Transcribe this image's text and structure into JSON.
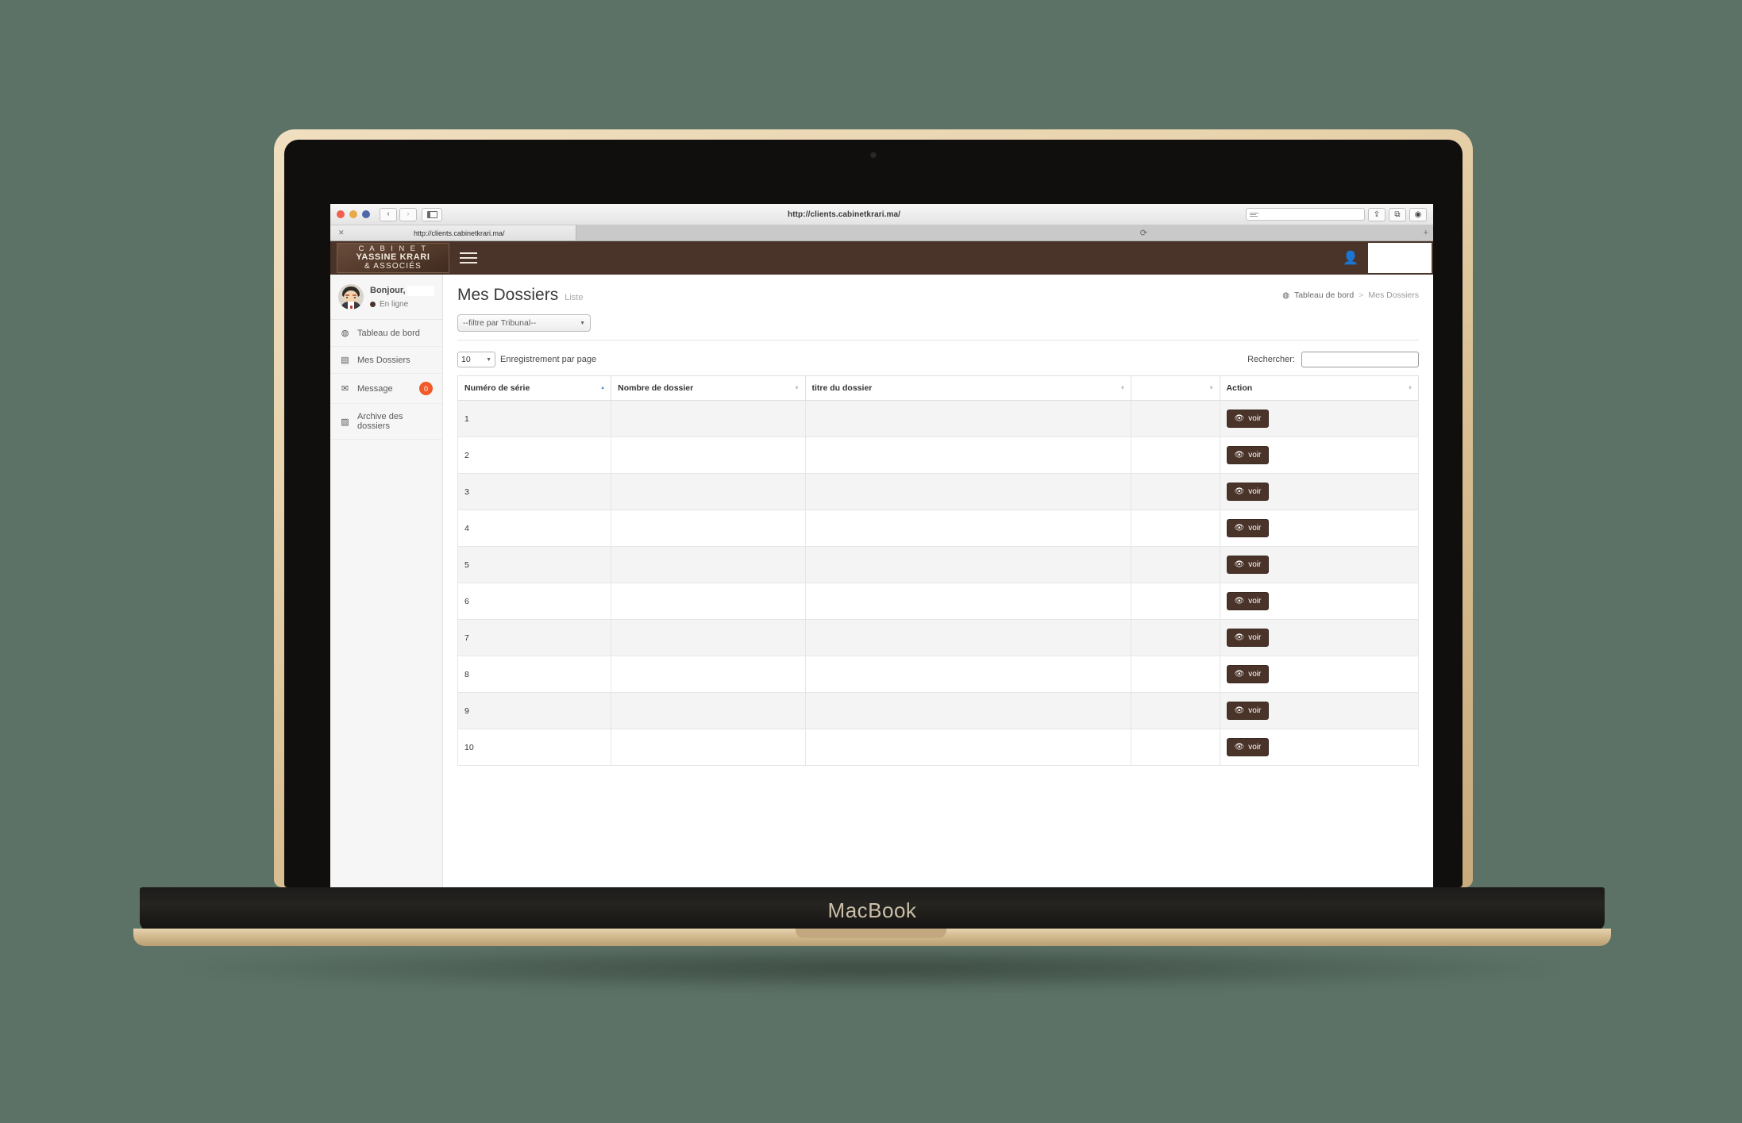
{
  "device": {
    "brand_label": "MacBook"
  },
  "browser": {
    "window_title": "http://clients.cabinetkrari.ma/",
    "back_icon": "‹",
    "forward_icon": "›",
    "sidebar_icon": "sidebar-icon",
    "share_icon": "⇪",
    "tabs_icon": "⧉",
    "settings_icon": "◉",
    "reload_icon": "⟳",
    "new_tab_icon": "+",
    "tab": {
      "title": "http://clients.cabinetkrari.ma/",
      "close_icon": "✕"
    }
  },
  "header": {
    "logo": {
      "line1": "C A B I N E T",
      "line2": "YASSINE KRARI",
      "line3": "& ASSOCIÉS"
    },
    "menu_icon": "hamburger-icon",
    "user_icon": "👤"
  },
  "sidebar": {
    "profile": {
      "greeting": "Bonjour,",
      "name_redacted": "",
      "status": "En ligne"
    },
    "items": [
      {
        "label": "Tableau de bord",
        "icon": "◍",
        "badge": null
      },
      {
        "label": "Mes Dossiers",
        "icon": "▤",
        "badge": null
      },
      {
        "label": "Message",
        "icon": "✉",
        "badge": "0"
      },
      {
        "label": "Archive des dossiers",
        "icon": "▨",
        "badge": null
      }
    ]
  },
  "main": {
    "page_title": "Mes Dossiers",
    "page_subtitle": "Liste",
    "breadcrumb": {
      "icon": "◍",
      "root": "Tableau de bord",
      "separator": ">",
      "current": "Mes Dossiers"
    },
    "filter": {
      "selected": "--filtre par Tribunal--",
      "caret": "▼"
    },
    "table_controls": {
      "page_length_value": "10",
      "page_length_caret": "▼",
      "page_length_label": "Enregistrement par page",
      "search_label": "Rechercher:",
      "search_value": "",
      "search_placeholder": ""
    },
    "table": {
      "columns": [
        {
          "label": "Numéro de série",
          "sort": "asc"
        },
        {
          "label": "Nombre de dossier",
          "sort": "none"
        },
        {
          "label": "titre du dossier",
          "sort": "none"
        },
        {
          "label": "",
          "sort": "none"
        },
        {
          "label": "Action",
          "sort": "none"
        }
      ],
      "action_button_label": "voir",
      "action_button_icon": "👁",
      "rows": [
        {
          "serie": "1",
          "nombre": "",
          "titre": "",
          "extra": ""
        },
        {
          "serie": "2",
          "nombre": "",
          "titre": "",
          "extra": ""
        },
        {
          "serie": "3",
          "nombre": "",
          "titre": "",
          "extra": ""
        },
        {
          "serie": "4",
          "nombre": "",
          "titre": "",
          "extra": ""
        },
        {
          "serie": "5",
          "nombre": "",
          "titre": "",
          "extra": ""
        },
        {
          "serie": "6",
          "nombre": "",
          "titre": "",
          "extra": ""
        },
        {
          "serie": "7",
          "nombre": "",
          "titre": "",
          "extra": ""
        },
        {
          "serie": "8",
          "nombre": "",
          "titre": "",
          "extra": ""
        },
        {
          "serie": "9",
          "nombre": "",
          "titre": "",
          "extra": ""
        },
        {
          "serie": "10",
          "nombre": "",
          "titre": "",
          "extra": ""
        }
      ]
    }
  },
  "colors": {
    "brand_brown": "#4a342a",
    "badge_orange": "#f05a28",
    "sort_active_blue": "#5b8fd1",
    "page_bg": "#5c7266"
  }
}
